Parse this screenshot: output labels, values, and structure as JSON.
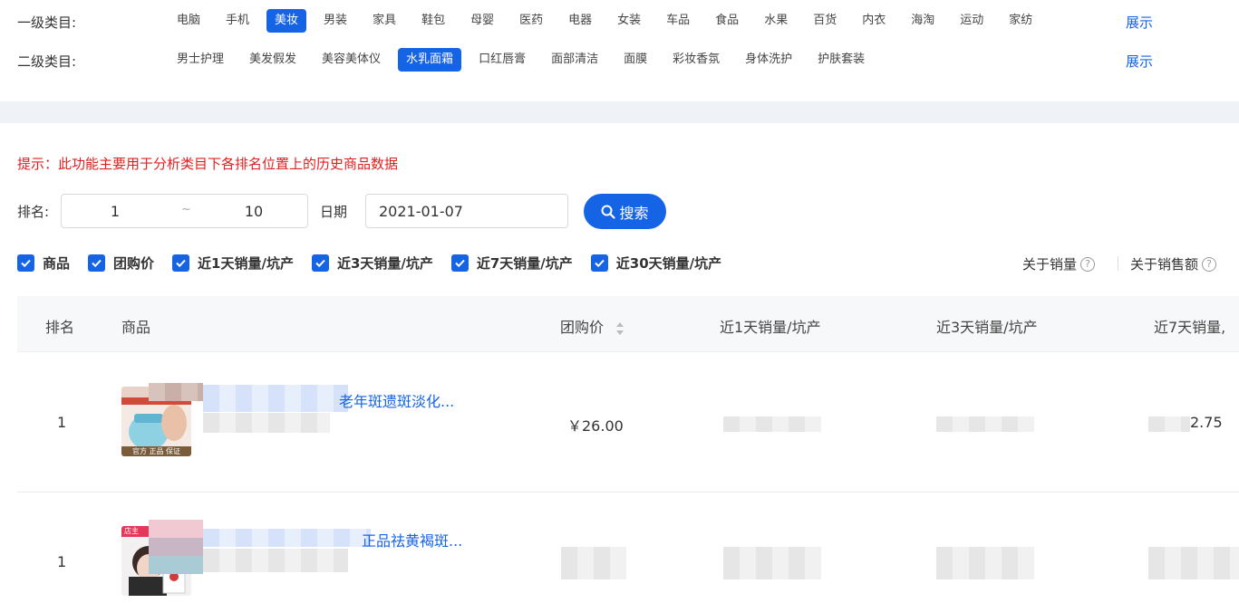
{
  "category": {
    "level1_label": "一级类目:",
    "level1_items": [
      "电脑",
      "手机",
      "美妆",
      "男装",
      "家具",
      "鞋包",
      "母婴",
      "医药",
      "电器",
      "女装",
      "车品",
      "食品",
      "水果",
      "百货",
      "内衣",
      "海淘",
      "运动",
      "家纺"
    ],
    "level1_active": "美妆",
    "level2_label": "二级类目:",
    "level2_items": [
      "男士护理",
      "美发假发",
      "美容美体仪",
      "水乳面霜",
      "口红唇膏",
      "面部清洁",
      "面膜",
      "彩妆香氛",
      "身体洗护",
      "护肤套装"
    ],
    "level2_active": "水乳面霜",
    "expand_label": "展示"
  },
  "hint": "提示：此功能主要用于分析类目下各排名位置上的历史商品数据",
  "search": {
    "rank_label": "排名:",
    "rank_from": "1",
    "rank_sep": "~",
    "rank_to": "10",
    "date_label": "日期",
    "date_value": "2021-01-07",
    "button_label": "搜索"
  },
  "columns_toggle": [
    "商品",
    "团购价",
    "近1天销量/坑产",
    "近3天销量/坑产",
    "近7天销量/坑产",
    "近30天销量/坑产"
  ],
  "about": {
    "sales": "关于销量",
    "amount": "关于销售额"
  },
  "table": {
    "headers": {
      "rank": "排名",
      "product": "商品",
      "price": "团购价",
      "d1": "近1天销量/坑产",
      "d3": "近3天销量/坑产",
      "d7": "近7天销量,"
    },
    "rows": [
      {
        "rank": "1",
        "title_tail": "老年斑遗斑淡化...",
        "price": "￥26.00",
        "d7_tail": "2.75",
        "img_badge": "官方 正品 保证"
      },
      {
        "rank": "1",
        "title_tail": "正品祛黄褐斑...",
        "price": "",
        "d7_tail": "",
        "img_badge": "店主"
      }
    ]
  },
  "colors": {
    "accent": "#1664e6",
    "hint": "#e02020"
  }
}
